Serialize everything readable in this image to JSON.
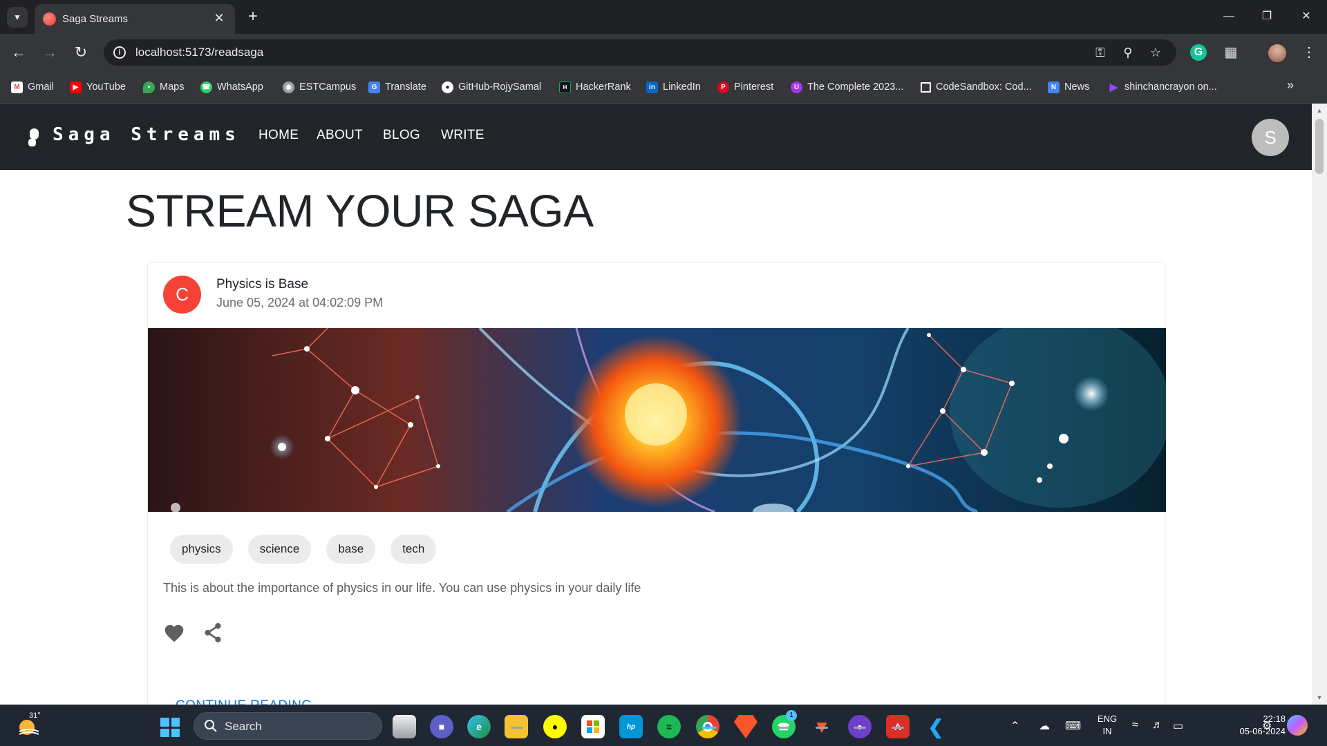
{
  "browser": {
    "tab_title": "Saga Streams",
    "url": "localhost:5173/readsaga",
    "bookmarks": [
      {
        "label": "Gmail",
        "icon": "gmail-icon",
        "color": "#ea4335"
      },
      {
        "label": "YouTube",
        "icon": "youtube-icon",
        "color": "#ff0000"
      },
      {
        "label": "Maps",
        "icon": "maps-icon",
        "color": "#34a853"
      },
      {
        "label": "WhatsApp",
        "icon": "whatsapp-icon",
        "color": "#25d366"
      },
      {
        "label": "ESTCampus",
        "icon": "globe-icon",
        "color": "#9aa0a6"
      },
      {
        "label": "Translate",
        "icon": "translate-icon",
        "color": "#4285f4"
      },
      {
        "label": "GitHub-RojySamal",
        "icon": "github-icon",
        "color": "#ffffff"
      },
      {
        "label": "HackerRank",
        "icon": "hackerrank-icon",
        "color": "#1ba94c"
      },
      {
        "label": "LinkedIn",
        "icon": "linkedin-icon",
        "color": "#0a66c2"
      },
      {
        "label": "Pinterest",
        "icon": "pinterest-icon",
        "color": "#e60023"
      },
      {
        "label": "The Complete 2023...",
        "icon": "udemy-icon",
        "color": "#a435f0"
      },
      {
        "label": "CodeSandbox: Cod...",
        "icon": "codesandbox-icon",
        "color": "#ffffff"
      },
      {
        "label": "News",
        "icon": "news-icon",
        "color": "#4285f4"
      },
      {
        "label": "shinchancrayon on...",
        "icon": "play-icon",
        "color": "#9146ff"
      }
    ]
  },
  "site": {
    "brand": "Saga Streams",
    "nav": [
      "HOME",
      "ABOUT",
      "BLOG",
      "WRITE"
    ],
    "user_initial": "S",
    "heading": "STREAM YOUR SAGA"
  },
  "post": {
    "author_initial": "C",
    "title": "Physics is Base",
    "date": "June 05, 2024 at 04:02:09 PM",
    "tags": [
      "physics",
      "science",
      "base",
      "tech"
    ],
    "excerpt": "This is about the importance of physics in our life. You can use physics in your daily life",
    "continue_label": "CONTINUE READING...",
    "accent_color": "#f44336",
    "link_color": "#1976d2"
  },
  "taskbar": {
    "weather_temp": "31°",
    "search_label": "Search",
    "whatsapp_badge": "1",
    "lang_line1": "ENG",
    "lang_line2": "IN",
    "time": "22:18",
    "date": "05-06-2024"
  }
}
